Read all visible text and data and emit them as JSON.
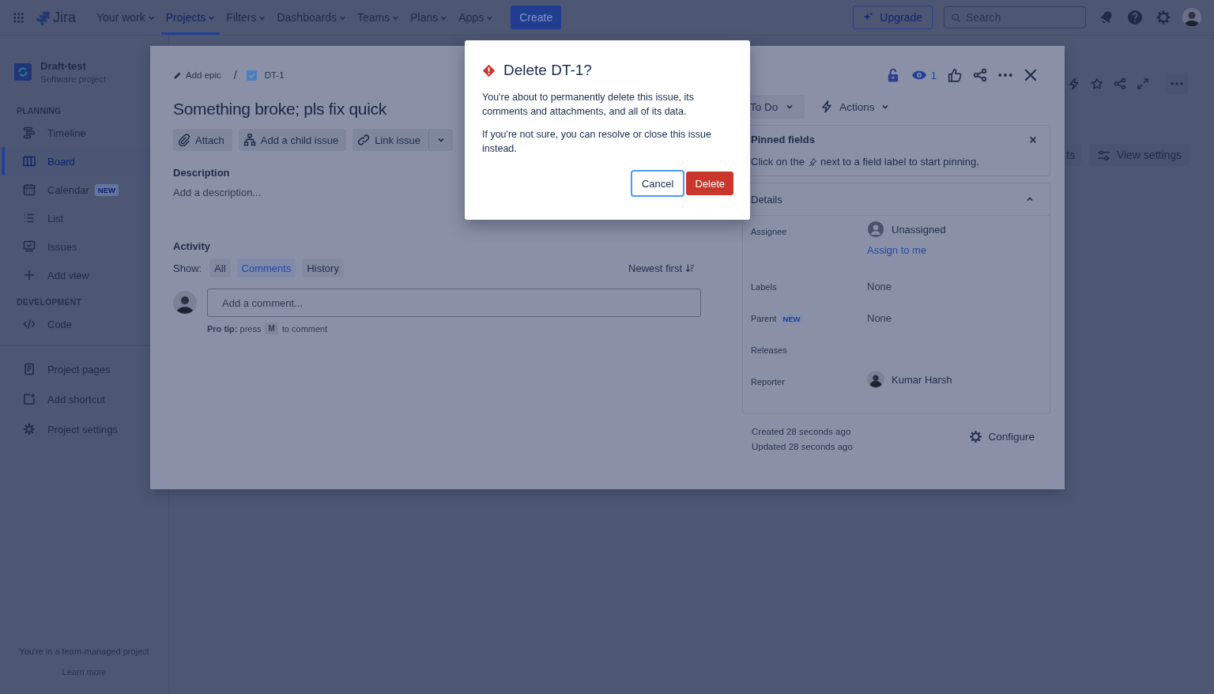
{
  "nav": {
    "logo": "Jira",
    "items": [
      {
        "label": "Your work",
        "selected": false
      },
      {
        "label": "Projects",
        "selected": true
      },
      {
        "label": "Filters",
        "selected": false
      },
      {
        "label": "Dashboards",
        "selected": false
      },
      {
        "label": "Teams",
        "selected": false
      },
      {
        "label": "Plans",
        "selected": false
      },
      {
        "label": "Apps",
        "selected": false
      }
    ],
    "create": "Create",
    "upgrade": "Upgrade",
    "search": {
      "placeholder": "Search"
    }
  },
  "sidebar": {
    "project": {
      "name": "Draft-test",
      "type": "Software project"
    },
    "sections": [
      {
        "heading": "PLANNING",
        "items": [
          {
            "label": "Timeline",
            "selected": false
          },
          {
            "label": "Board",
            "selected": true
          },
          {
            "label": "Calendar",
            "badge": "NEW",
            "selected": false
          },
          {
            "label": "List",
            "selected": false
          },
          {
            "label": "Issues",
            "selected": false
          },
          {
            "label": "Add view",
            "selected": false
          }
        ]
      },
      {
        "heading": "DEVELOPMENT",
        "items": [
          {
            "label": "Code",
            "selected": false
          }
        ]
      },
      {
        "items": [
          {
            "label": "Project pages",
            "selected": false
          },
          {
            "label": "Add shortcut",
            "selected": false
          },
          {
            "label": "Project settings",
            "selected": false
          }
        ]
      }
    ],
    "footer": {
      "note": "You're in a team-managed project",
      "link": "Learn more"
    }
  },
  "board": {
    "partial_button": "ts",
    "view_settings": "View settings"
  },
  "issue": {
    "breadcrumb": {
      "epic": "Add epic",
      "separator": "/",
      "key": "DT-1"
    },
    "title": "Something broke; pls fix quick",
    "actions": [
      "Attach",
      "Add a child issue",
      "Link issue"
    ],
    "description": {
      "label": "Description",
      "placeholder": "Add a description..."
    },
    "activity": {
      "label": "Activity",
      "show": "Show:",
      "filters": [
        {
          "label": "All",
          "selected": false
        },
        {
          "label": "Comments",
          "selected": true
        },
        {
          "label": "History",
          "selected": false
        }
      ],
      "sort": "Newest first"
    },
    "comment": {
      "placeholder": "Add a comment...",
      "tip": "**Pro tip:** press",
      "key": "M",
      "tip_end": "to comment"
    },
    "watchers": "1",
    "status": "To Do",
    "actions_menu": "Actions",
    "pinned": {
      "title": "Pinned fields",
      "text_start": "Click on the",
      "text_end": "next to a field label to start pinning."
    },
    "details": {
      "title": "Details",
      "expanded": true,
      "fields": [
        {
          "label": "Assignee",
          "kind": "unassigned",
          "value": "Unassigned",
          "link": "Assign to me"
        },
        {
          "label": "Labels",
          "kind": "text",
          "value": "None"
        },
        {
          "label": "Parent",
          "badge": "NEW",
          "kind": "text",
          "value": "None"
        },
        {
          "label": "Releases",
          "kind": "empty"
        },
        {
          "label": "Reporter",
          "kind": "user",
          "value": "Kumar Harsh"
        }
      ]
    },
    "created": "Created 28 seconds ago",
    "updated": "Updated 28 seconds ago",
    "configure": "Configure"
  },
  "dialog": {
    "title": "Delete DT-1?",
    "paragraphs": [
      "You're about to permanently delete this issue, its comments and attachments, and all of its data.",
      "If you're not sure, you can resolve or close this issue instead."
    ],
    "cancel": "Cancel",
    "confirm": "Delete"
  }
}
